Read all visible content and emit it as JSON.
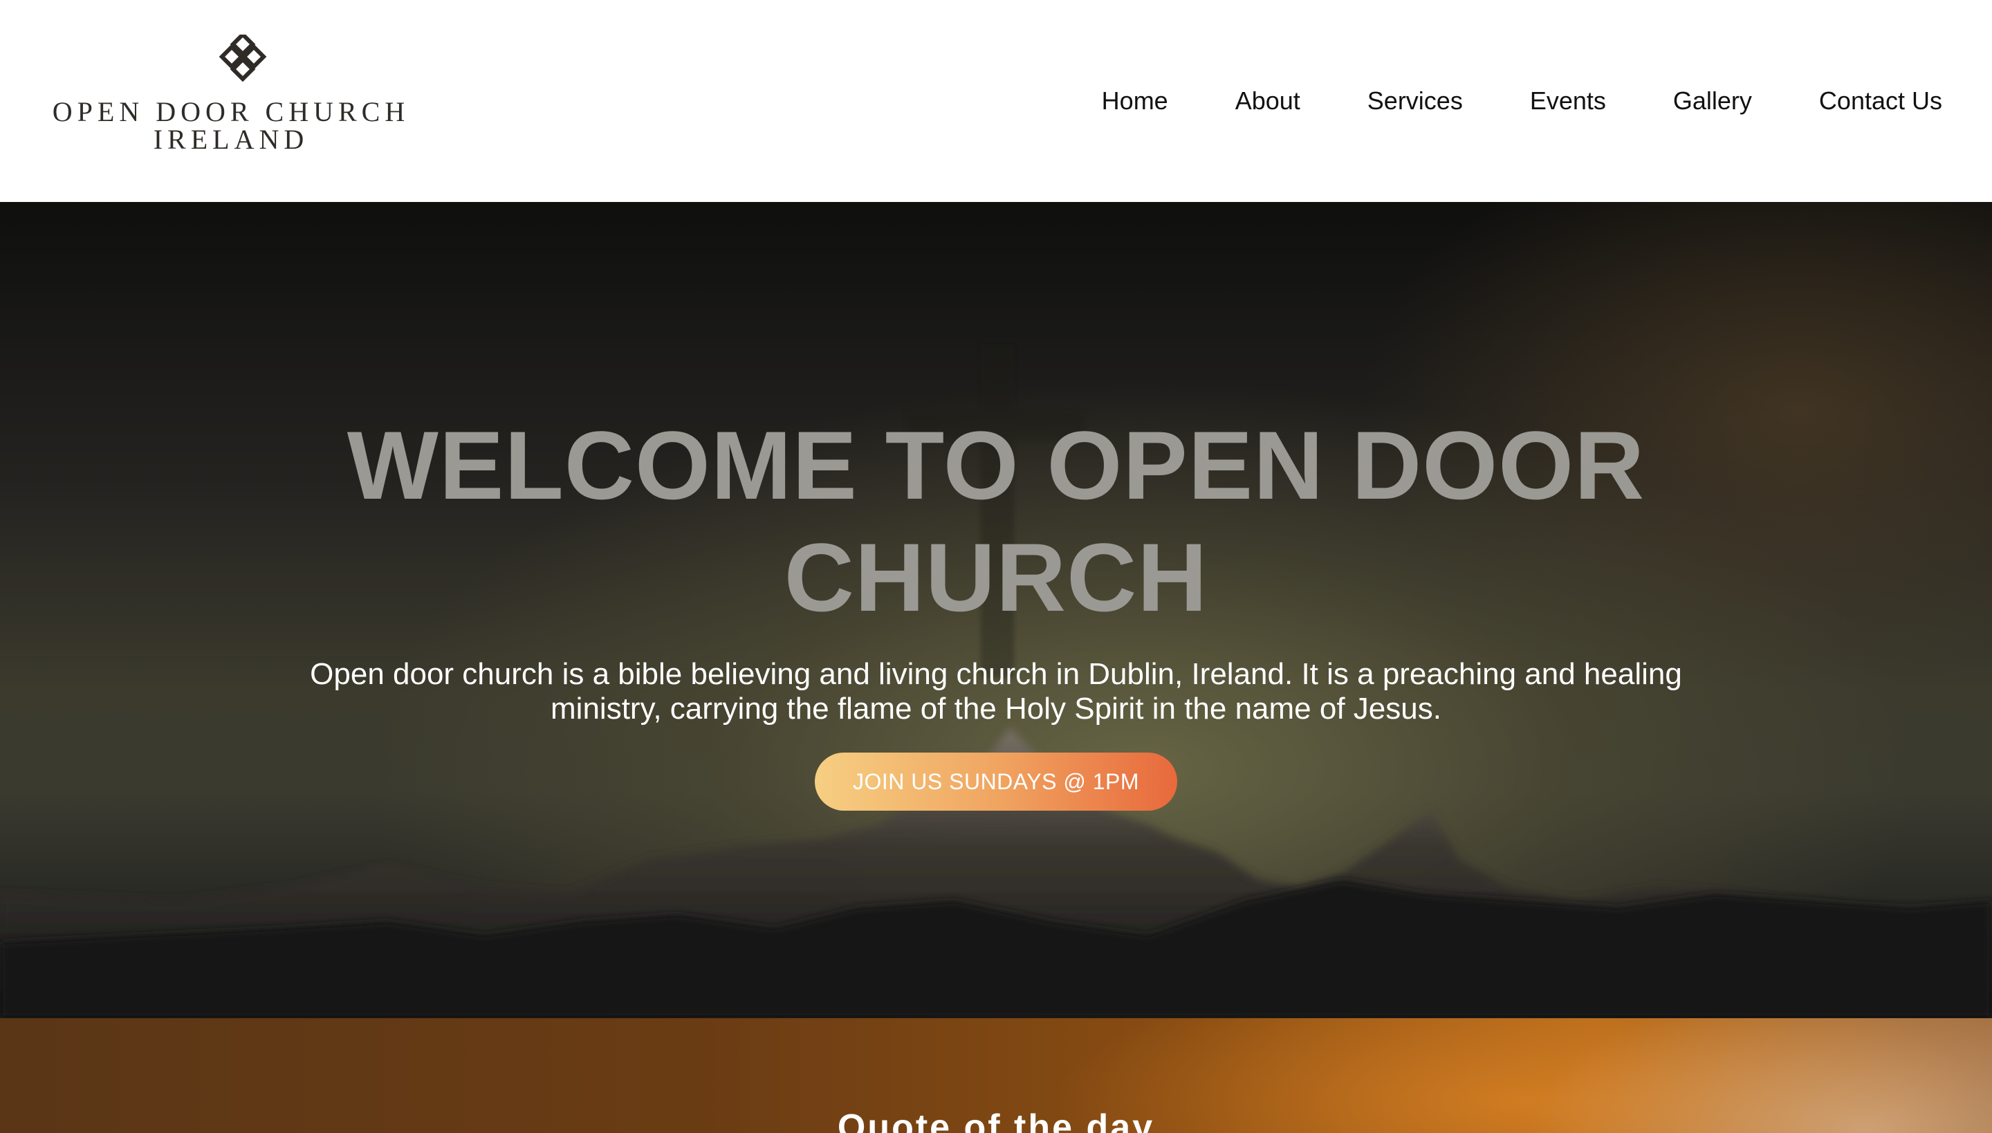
{
  "header": {
    "logo": {
      "line1": "OPEN DOOR CHURCH",
      "line2": "IRELAND",
      "icon": "celtic-knot-icon"
    },
    "nav": [
      {
        "label": "Home"
      },
      {
        "label": "About"
      },
      {
        "label": "Services"
      },
      {
        "label": "Events"
      },
      {
        "label": "Gallery"
      },
      {
        "label": "Contact Us"
      }
    ]
  },
  "hero": {
    "title": "WELCOME TO OPEN DOOR CHURCH",
    "description": "Open door church is a bible believing and living church in Dublin, Ireland. It is a preaching and healing ministry, carrying the flame of the Holy Spirit in the name of Jesus.",
    "cta_label": "JOIN US SUNDAYS @ 1PM"
  },
  "quote": {
    "heading": "Quote of the day"
  },
  "colors": {
    "cta_gradient_start": "#f6cf82",
    "cta_gradient_end": "#e8693c",
    "logo_text": "#2f2c28",
    "hero_title": "#9a9994"
  }
}
